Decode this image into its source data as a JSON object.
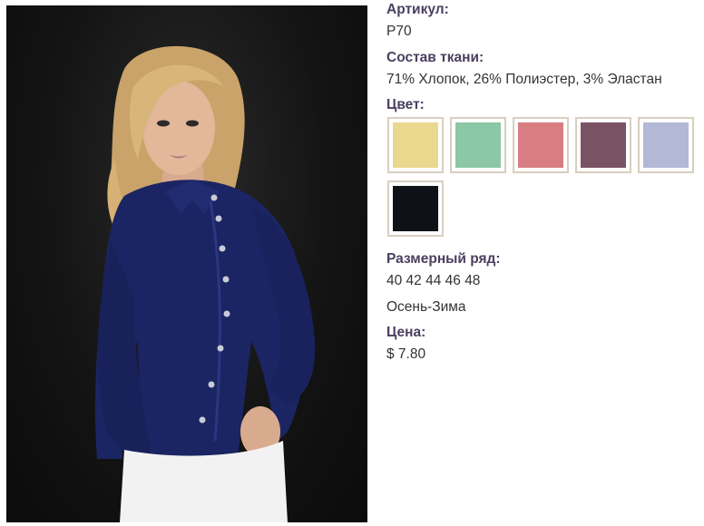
{
  "product": {
    "article_label": "Артикул:",
    "article_value": "P70",
    "fabric_label": "Состав ткани:",
    "fabric_value": "71% Хлопок, 26% Полиэстер, 3% Эластан",
    "color_label": "Цвет:",
    "colors": [
      {
        "name": "yellow",
        "hex": "#ead88e"
      },
      {
        "name": "mint",
        "hex": "#8cc7a6"
      },
      {
        "name": "pink",
        "hex": "#d87d82"
      },
      {
        "name": "plum",
        "hex": "#7a5363"
      },
      {
        "name": "lavender",
        "hex": "#b2b8d6"
      },
      {
        "name": "black",
        "hex": "#0f1118"
      }
    ],
    "sizes_label": "Размерный ряд:",
    "sizes_value": "40 42 44 46 48",
    "season_value": "Осень-Зима",
    "price_label": "Цена:",
    "price_value": "$ 7.80"
  },
  "photo": {
    "description_icon": "model-photo",
    "shirt_color": "#1b2563",
    "background_color": "#141414"
  }
}
